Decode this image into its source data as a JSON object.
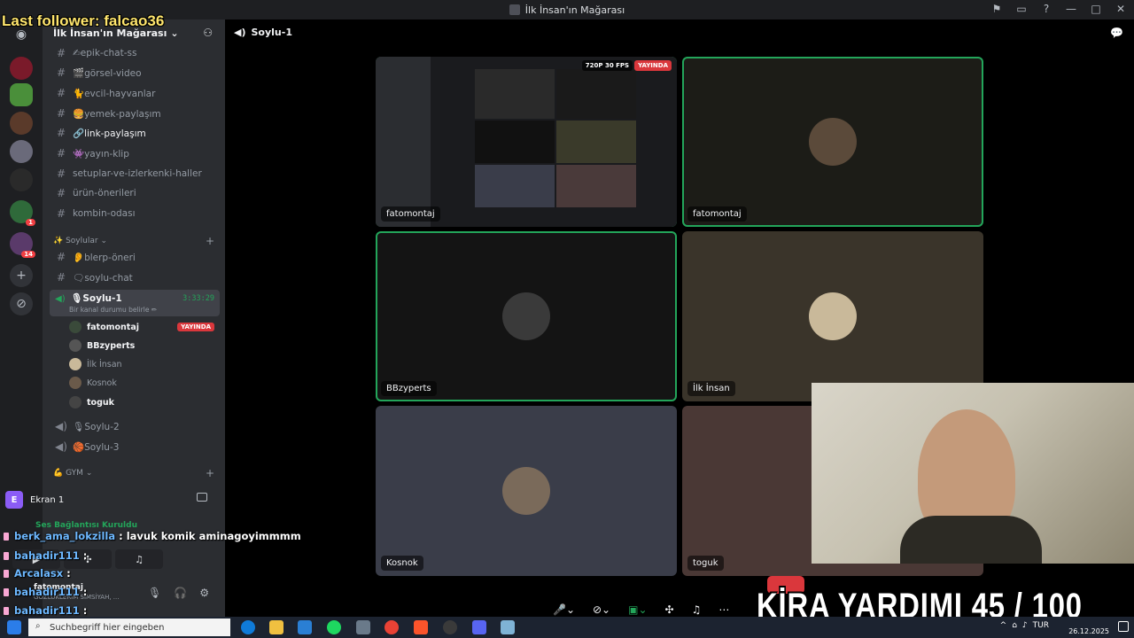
{
  "window": {
    "title": "İlk İnsan'ın Mağarası"
  },
  "overlay": {
    "last_follower": "Last follower: falcao36",
    "goal": "KİRA YARDIMI  45 / 100",
    "goal_progress": 0.45,
    "chat": [
      {
        "user": "berk_ama_lokzilla",
        "msg": " : lavuk komik aminagoyimmmm"
      },
      {
        "user": "bahadir111",
        "msg": " :"
      },
      {
        "user": "Arcalasx",
        "msg": " :"
      },
      {
        "user": "bahadir111",
        "msg": " :"
      },
      {
        "user": "bahadir111",
        "msg": " :"
      }
    ]
  },
  "server": {
    "name": "İlk İnsan'ın Mağarası",
    "rail_badges": [
      "1",
      "14"
    ],
    "channels": [
      {
        "icon": "#",
        "label": "✍epik-chat-ss"
      },
      {
        "icon": "#",
        "label": "🎬görsel-video"
      },
      {
        "icon": "#",
        "label": "🐈evcil-hayvanlar"
      },
      {
        "icon": "#",
        "label": "🍔yemek-paylaşım"
      },
      {
        "icon": "#",
        "label": "🔗link-paylaşım",
        "active": true
      },
      {
        "icon": "#",
        "label": "👾yayın-klip"
      },
      {
        "icon": "#",
        "label": "setuplar-ve-izlerkenki-haller"
      },
      {
        "icon": "#",
        "label": "ürün-önerileri"
      },
      {
        "icon": "#",
        "label": "kombin-odası"
      }
    ],
    "category_soylular": "✨ Soylular",
    "soylular_channels": [
      {
        "icon": "#",
        "label": "👂blerp-öneri"
      },
      {
        "icon": "#",
        "label": "🗨soylu-chat"
      }
    ],
    "voice_active": {
      "name": "🎙Soylu-1",
      "status": "Bir kanal durumu belirle ✏",
      "time": "3:33:29"
    },
    "voice_users": [
      {
        "name": "fatomontaj",
        "live": "YAYINDA",
        "bold": true
      },
      {
        "name": "BBzyperts",
        "bold": true
      },
      {
        "name": "İlk İnsan"
      },
      {
        "name": "Kosnok"
      },
      {
        "name": "toguk",
        "bold": true
      }
    ],
    "voice_channels": [
      {
        "label": "🎙Soylu-2"
      },
      {
        "label": "🏀Soylu-3"
      }
    ],
    "category_gym": "💪 GYM"
  },
  "panel": {
    "screen_label": "Ekran 1",
    "screen_letter": "E",
    "connection": "Ses Bağlantısı Kuruldu",
    "user_name": "fatomontaj",
    "user_status": "GÖZLÜKLERİM SİMSİYAH, ..."
  },
  "stage": {
    "channel": "Soylu-1",
    "tiles": [
      {
        "name": "fatomontaj",
        "type": "share",
        "quality": "720P 30 FPS",
        "live": "YAYINDA"
      },
      {
        "name": "fatomontaj",
        "type": "avatar"
      },
      {
        "name": "BBzyperts",
        "type": "avatar"
      },
      {
        "name": "İlk İnsan",
        "type": "avatar"
      },
      {
        "name": "Kosnok",
        "type": "avatar"
      },
      {
        "name": "toguk",
        "type": "avatar"
      }
    ]
  },
  "taskbar": {
    "search_placeholder": "Suchbegriff hier eingeben",
    "lang": "TUR",
    "date": "26.12.2025"
  },
  "colors": {
    "accent_green": "#23a55a",
    "live_red": "#da373c",
    "follower_yellow": "#ffe66d"
  }
}
